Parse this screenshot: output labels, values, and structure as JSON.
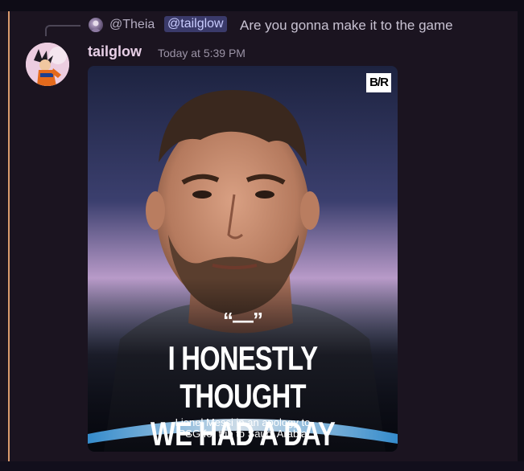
{
  "reply": {
    "author": "@Theia",
    "mention": "@tailglow",
    "text": "Are you gonna make it to the game"
  },
  "message": {
    "username": "tailglow",
    "timestamp": "Today at 5:39 PM"
  },
  "attachment": {
    "logo": "B/R",
    "quote_mark": "“—”",
    "headline_line1": "I HONESTLY THOUGHT",
    "headline_line2": "WE HAD A DAY OFF...",
    "caption_line1": "Lionel Messi in an apology to",
    "caption_line2": "PSG for trip to Saudi Arabia"
  },
  "colors": {
    "accent_bar": "#d99a6e",
    "mention_bg": "#3a3a6a",
    "username": "#e7cfe6"
  }
}
